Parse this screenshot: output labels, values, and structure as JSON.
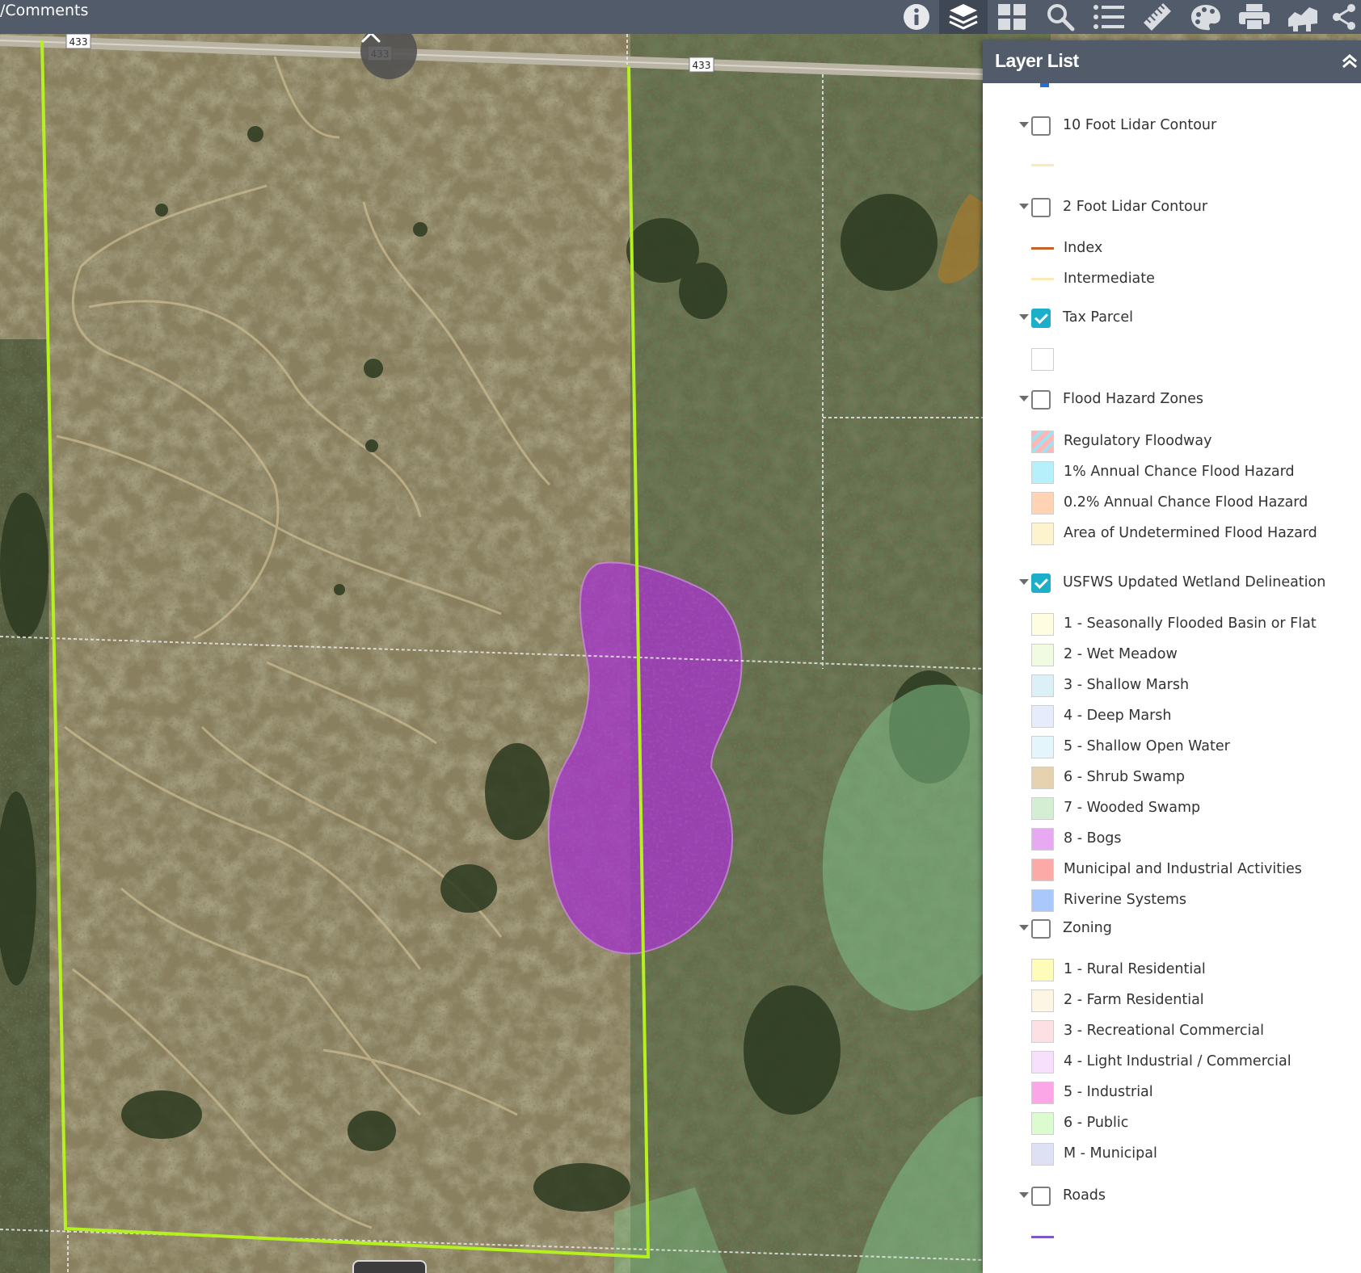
{
  "header": {
    "title": "/Comments",
    "tools": [
      {
        "name": "about",
        "icon": "info-icon"
      },
      {
        "name": "layer-list",
        "icon": "layers-icon",
        "active": true
      },
      {
        "name": "basemap-gallery",
        "icon": "grid-icon"
      },
      {
        "name": "search",
        "icon": "search-icon"
      },
      {
        "name": "legend",
        "icon": "list-icon"
      },
      {
        "name": "measurement",
        "icon": "ruler-icon"
      },
      {
        "name": "draw",
        "icon": "palette-icon"
      },
      {
        "name": "print",
        "icon": "printer-icon"
      },
      {
        "name": "elevation",
        "icon": "chart-icon"
      },
      {
        "name": "share",
        "icon": "share-icon"
      }
    ]
  },
  "map": {
    "road_labels": [
      "433",
      "433",
      "433"
    ]
  },
  "layer_panel": {
    "title": "Layer List",
    "layers": [
      {
        "label": "10 Foot Lidar Contour",
        "checked": false,
        "legend": [
          {
            "type": "line",
            "color": "#fbe9b8",
            "label": ""
          }
        ]
      },
      {
        "label": "2 Foot Lidar Contour",
        "checked": false,
        "legend": [
          {
            "type": "line",
            "color": "#c95f2a",
            "label": "Index"
          },
          {
            "type": "line",
            "color": "#fbe9b8",
            "label": "Intermediate"
          }
        ]
      },
      {
        "label": "Tax Parcel",
        "checked": true,
        "legend": [
          {
            "type": "fill",
            "color": "#ffffff",
            "label": ""
          }
        ]
      },
      {
        "label": "Flood Hazard Zones",
        "checked": false,
        "legend": [
          {
            "type": "hatch",
            "color": "#ffb6b6",
            "label": "Regulatory Floodway"
          },
          {
            "type": "fill",
            "color": "#b6f0fb",
            "label": "1% Annual Chance Flood Hazard"
          },
          {
            "type": "fill",
            "color": "#ffd3b3",
            "label": "0.2% Annual Chance Flood Hazard"
          },
          {
            "type": "fill",
            "color": "#fdf4cd",
            "label": "Area of Undetermined Flood Hazard"
          }
        ]
      },
      {
        "label": "USFWS Updated Wetland Delineation",
        "checked": true,
        "legend": [
          {
            "type": "fill",
            "color": "#fefde2",
            "label": "1 - Seasonally Flooded Basin or Flat"
          },
          {
            "type": "fill",
            "color": "#f1fbe1",
            "label": "2 - Wet Meadow"
          },
          {
            "type": "fill",
            "color": "#dcf1f7",
            "label": "3 - Shallow Marsh"
          },
          {
            "type": "fill",
            "color": "#e6ecfb",
            "label": "4 - Deep Marsh"
          },
          {
            "type": "fill",
            "color": "#e4f6fb",
            "label": "5 - Shallow Open Water"
          },
          {
            "type": "fill",
            "color": "#e6d2ae",
            "label": "6 - Shrub Swamp"
          },
          {
            "type": "fill",
            "color": "#d4eed4",
            "label": "7 - Wooded Swamp"
          },
          {
            "type": "fill",
            "color": "#e7aaf2",
            "label": "8 - Bogs"
          },
          {
            "type": "fill",
            "color": "#fbaaa8",
            "label": "Municipal and Industrial Activities"
          },
          {
            "type": "fill",
            "color": "#aac8fb",
            "label": "Riverine Systems"
          }
        ]
      },
      {
        "label": "Zoning",
        "checked": false,
        "legend": [
          {
            "type": "fill",
            "color": "#fefcb8",
            "label": "1 - Rural Residential"
          },
          {
            "type": "fill",
            "color": "#fdf6e4",
            "label": "2 - Farm Residential"
          },
          {
            "type": "fill",
            "color": "#fde0e4",
            "label": "3 - Recreational Commercial"
          },
          {
            "type": "fill",
            "color": "#f6e0fb",
            "label": "4 - Light Industrial / Commercial"
          },
          {
            "type": "fill",
            "color": "#fba6e6",
            "label": "5 - Industrial"
          },
          {
            "type": "fill",
            "color": "#dcfbcf",
            "label": "6 - Public"
          },
          {
            "type": "fill",
            "color": "#dde1f3",
            "label": "M - Municipal"
          }
        ]
      },
      {
        "label": "Roads",
        "checked": false,
        "legend": [
          {
            "type": "line",
            "color": "#7b5ac8",
            "label": ""
          }
        ]
      }
    ]
  }
}
